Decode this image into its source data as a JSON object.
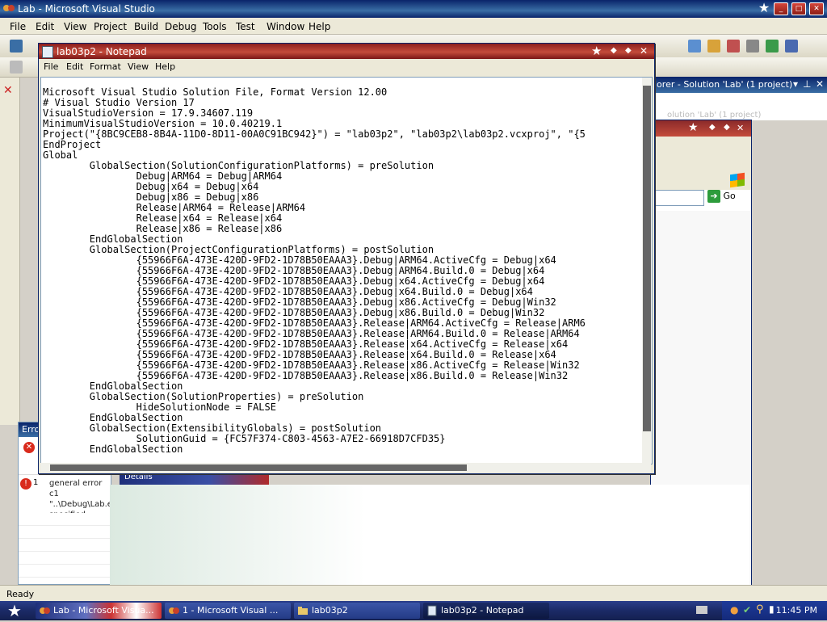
{
  "vs": {
    "title": "Lab - Microsoft Visual Studio",
    "menu": [
      "File",
      "Edit",
      "View",
      "Project",
      "Build",
      "Debug",
      "Tools",
      "Test",
      "Window",
      "Help"
    ],
    "status": "Ready"
  },
  "solution_explorer": {
    "title": "lorer - Solution 'Lab' (1 project)",
    "faint_line": "olution 'Lab' (1 project)"
  },
  "error_list": {
    "tab": "Erro",
    "row_num": "1",
    "row_text": "general error c1 \"..\\Debug\\Lab.e specified."
  },
  "browser": {
    "go_label": "Go"
  },
  "details_banner": "Details",
  "notepad": {
    "title": "lab03p2 - Notepad",
    "menu": [
      "File",
      "Edit",
      "Format",
      "View",
      "Help"
    ],
    "content": "Microsoft Visual Studio Solution File, Format Version 12.00\n# Visual Studio Version 17\nVisualStudioVersion = 17.9.34607.119\nMinimumVisualStudioVersion = 10.0.40219.1\nProject(\"{8BC9CEB8-8B4A-11D0-8D11-00A0C91BC942}\") = \"lab03p2\", \"lab03p2\\lab03p2.vcxproj\", \"{5\nEndProject\nGlobal\n\tGlobalSection(SolutionConfigurationPlatforms) = preSolution\n\t\tDebug|ARM64 = Debug|ARM64\n\t\tDebug|x64 = Debug|x64\n\t\tDebug|x86 = Debug|x86\n\t\tRelease|ARM64 = Release|ARM64\n\t\tRelease|x64 = Release|x64\n\t\tRelease|x86 = Release|x86\n\tEndGlobalSection\n\tGlobalSection(ProjectConfigurationPlatforms) = postSolution\n\t\t{55966F6A-473E-420D-9FD2-1D78B50EAAA3}.Debug|ARM64.ActiveCfg = Debug|x64\n\t\t{55966F6A-473E-420D-9FD2-1D78B50EAAA3}.Debug|ARM64.Build.0 = Debug|x64\n\t\t{55966F6A-473E-420D-9FD2-1D78B50EAAA3}.Debug|x64.ActiveCfg = Debug|x64\n\t\t{55966F6A-473E-420D-9FD2-1D78B50EAAA3}.Debug|x64.Build.0 = Debug|x64\n\t\t{55966F6A-473E-420D-9FD2-1D78B50EAAA3}.Debug|x86.ActiveCfg = Debug|Win32\n\t\t{55966F6A-473E-420D-9FD2-1D78B50EAAA3}.Debug|x86.Build.0 = Debug|Win32\n\t\t{55966F6A-473E-420D-9FD2-1D78B50EAAA3}.Release|ARM64.ActiveCfg = Release|ARM6\n\t\t{55966F6A-473E-420D-9FD2-1D78B50EAAA3}.Release|ARM64.Build.0 = Release|ARM64\n\t\t{55966F6A-473E-420D-9FD2-1D78B50EAAA3}.Release|x64.ActiveCfg = Release|x64\n\t\t{55966F6A-473E-420D-9FD2-1D78B50EAAA3}.Release|x64.Build.0 = Release|x64\n\t\t{55966F6A-473E-420D-9FD2-1D78B50EAAA3}.Release|x86.ActiveCfg = Release|Win32\n\t\t{55966F6A-473E-420D-9FD2-1D78B50EAAA3}.Release|x86.Build.0 = Release|Win32\n\tEndGlobalSection\n\tGlobalSection(SolutionProperties) = preSolution\n\t\tHideSolutionNode = FALSE\n\tEndGlobalSection\n\tGlobalSection(ExtensibilityGlobals) = postSolution\n\t\tSolutionGuid = {FC57F374-C803-4563-A7E2-66918D7CFD35}\n\tEndGlobalSection"
  },
  "taskbar": {
    "items": [
      "Lab - Microsoft Visua...",
      "1 - Microsoft Visual ...",
      "lab03p2",
      "lab03p2 - Notepad"
    ],
    "clock": "11:45 PM"
  },
  "colors": {
    "xp_titlebar": "#0a246a",
    "notepad_titlebar": "#c44b3b",
    "taskbar": "#1b2a66"
  }
}
